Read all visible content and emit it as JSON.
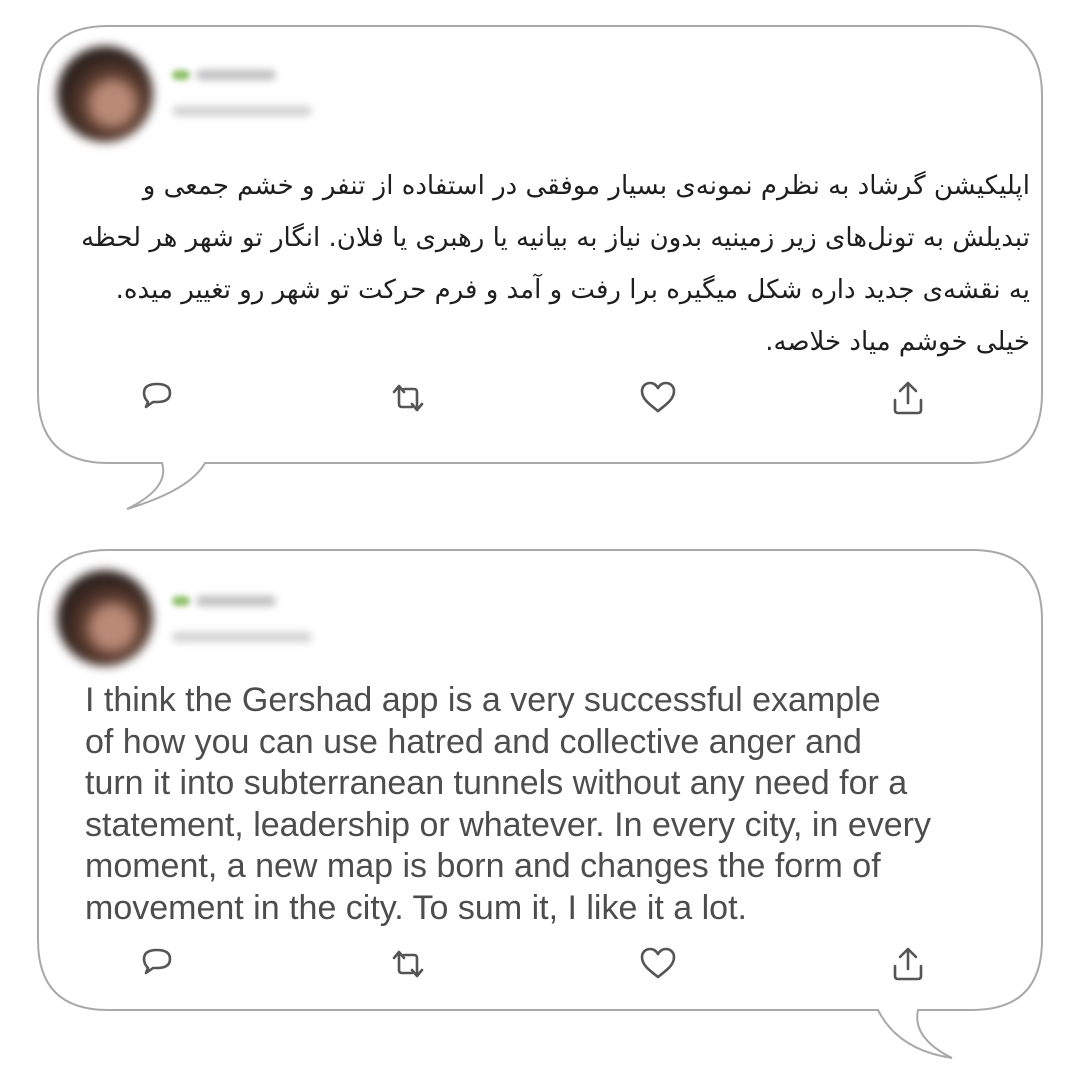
{
  "tweets": [
    {
      "text": "اپلیکیشن گرشاد به نظرم نمونه‌ی بسیار موفقی در استفاده از تنفر و خشم جمعی و تبدیلش به تونل‌های زیر زمینیه بدون نیاز به بیانیه یا رهبری یا فلان. انگار تو شهر هر لحظه یه نقشه‌ی جدید داره شکل میگیره برا رفت و آمد و فرم حرکت تو شهر رو تغییر میده. خیلی خوشم میاد خلاصه.",
      "actions": [
        "reply-icon",
        "retweet-icon",
        "like-icon",
        "share-icon"
      ]
    },
    {
      "text": "I think the Gershad app is a very successful example\nof how you can use hatred and collective anger and\nturn it into subterranean tunnels without any need for a\nstatement, leadership or whatever. In every city, in every\nmoment, a new map is born and changes the form of\nmovement in the city. To sum it, I like it a lot.",
      "actions": [
        "reply-icon",
        "retweet-icon",
        "like-icon",
        "share-icon"
      ]
    }
  ],
  "colors": {
    "bubble_border": "#a9a9a9",
    "icon": "#555555",
    "verified": "#8fbf6a"
  }
}
